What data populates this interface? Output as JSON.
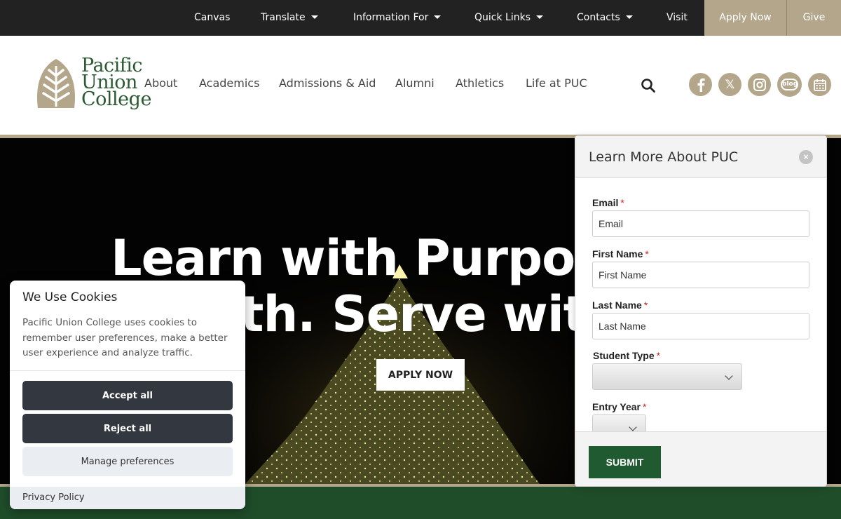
{
  "topbar": {
    "items": [
      {
        "label": "Canvas"
      },
      {
        "label": "Translate"
      },
      {
        "label": "Information For"
      },
      {
        "label": "Quick Links"
      },
      {
        "label": "Contacts"
      },
      {
        "label": "Visit"
      },
      {
        "label": "Apply Now"
      },
      {
        "label": "Give"
      }
    ]
  },
  "logo": {
    "line1": "Pacific",
    "line2": "Union",
    "line3": "College"
  },
  "nav": {
    "items": [
      {
        "label": "About"
      },
      {
        "label": "Academics"
      },
      {
        "label": "Admissions & Aid"
      },
      {
        "label": "Alumni"
      },
      {
        "label": "Athletics"
      },
      {
        "label": "Life at PUC"
      }
    ]
  },
  "social": {
    "blog_label": "blog",
    "x_label": "𝕏"
  },
  "hero": {
    "line1": "Learn with Purpose.",
    "line2": "th. Serve with L",
    "apply_label": "APPLY NOW"
  },
  "cookie": {
    "title": "We Use Cookies",
    "text": "Pacific Union College uses cookies to remember user preferences, make a better user experience and analyze traffic.",
    "accept_label": "Accept all",
    "reject_label": "Reject all",
    "manage_label": "Manage preferences",
    "policy_label": "Privacy Policy"
  },
  "form": {
    "title": "Learn More About PUC",
    "close_glyph": "×",
    "required_mark": "*",
    "email_label": "Email",
    "email_value": "Email",
    "first_label": "First Name",
    "first_value": "First Name",
    "last_label": "Last Name",
    "last_value": "Last Name",
    "student_type_label": "Student Type",
    "entry_year_label": "Entry Year",
    "submit_label": "SUBMIT"
  },
  "colors": {
    "brand_green": "#1f5a30",
    "brand_tan": "#b3a68a",
    "topbar_bg": "#222222"
  }
}
